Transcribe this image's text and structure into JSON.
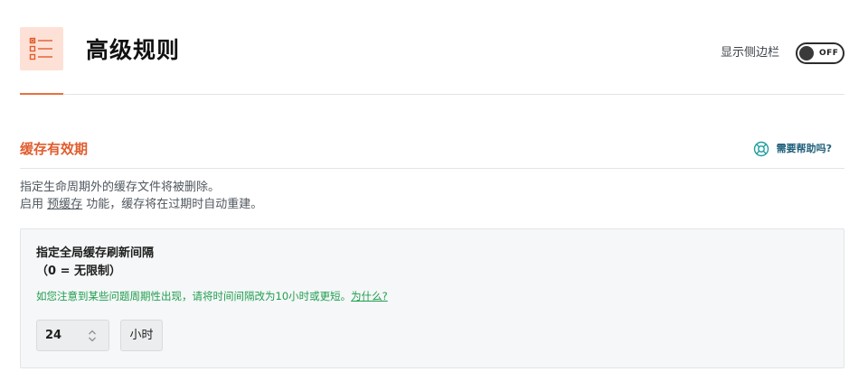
{
  "header": {
    "title": "高级规则",
    "sidebar_toggle_label": "显示侧边栏",
    "sidebar_toggle_state": "OFF",
    "icon": "list-checklist-icon"
  },
  "section": {
    "title": "缓存有效期",
    "help_label": "需要帮助吗?",
    "help_icon": "lifebuoy-icon"
  },
  "description": {
    "line1": "指定生命周期外的缓存文件将被删除。",
    "line2_prefix": "启用 ",
    "line2_link": "预缓存",
    "line2_suffix": " 功能，缓存将在过期时自动重建。"
  },
  "panel": {
    "title_line1": "指定全局缓存刷新间隔",
    "title_line2": "（0 = 无限制）",
    "hint_text": "如您注意到某些问题周期性出现，请将时间间隔改为10小时或更短。",
    "hint_link": "为什么?",
    "interval_value": "24",
    "unit_label": "小时"
  },
  "colors": {
    "accent": "#e05d2e",
    "accent_bg": "#fde1d6",
    "hint_green": "#1e9e4e",
    "help_blue": "#1e5f7a"
  }
}
